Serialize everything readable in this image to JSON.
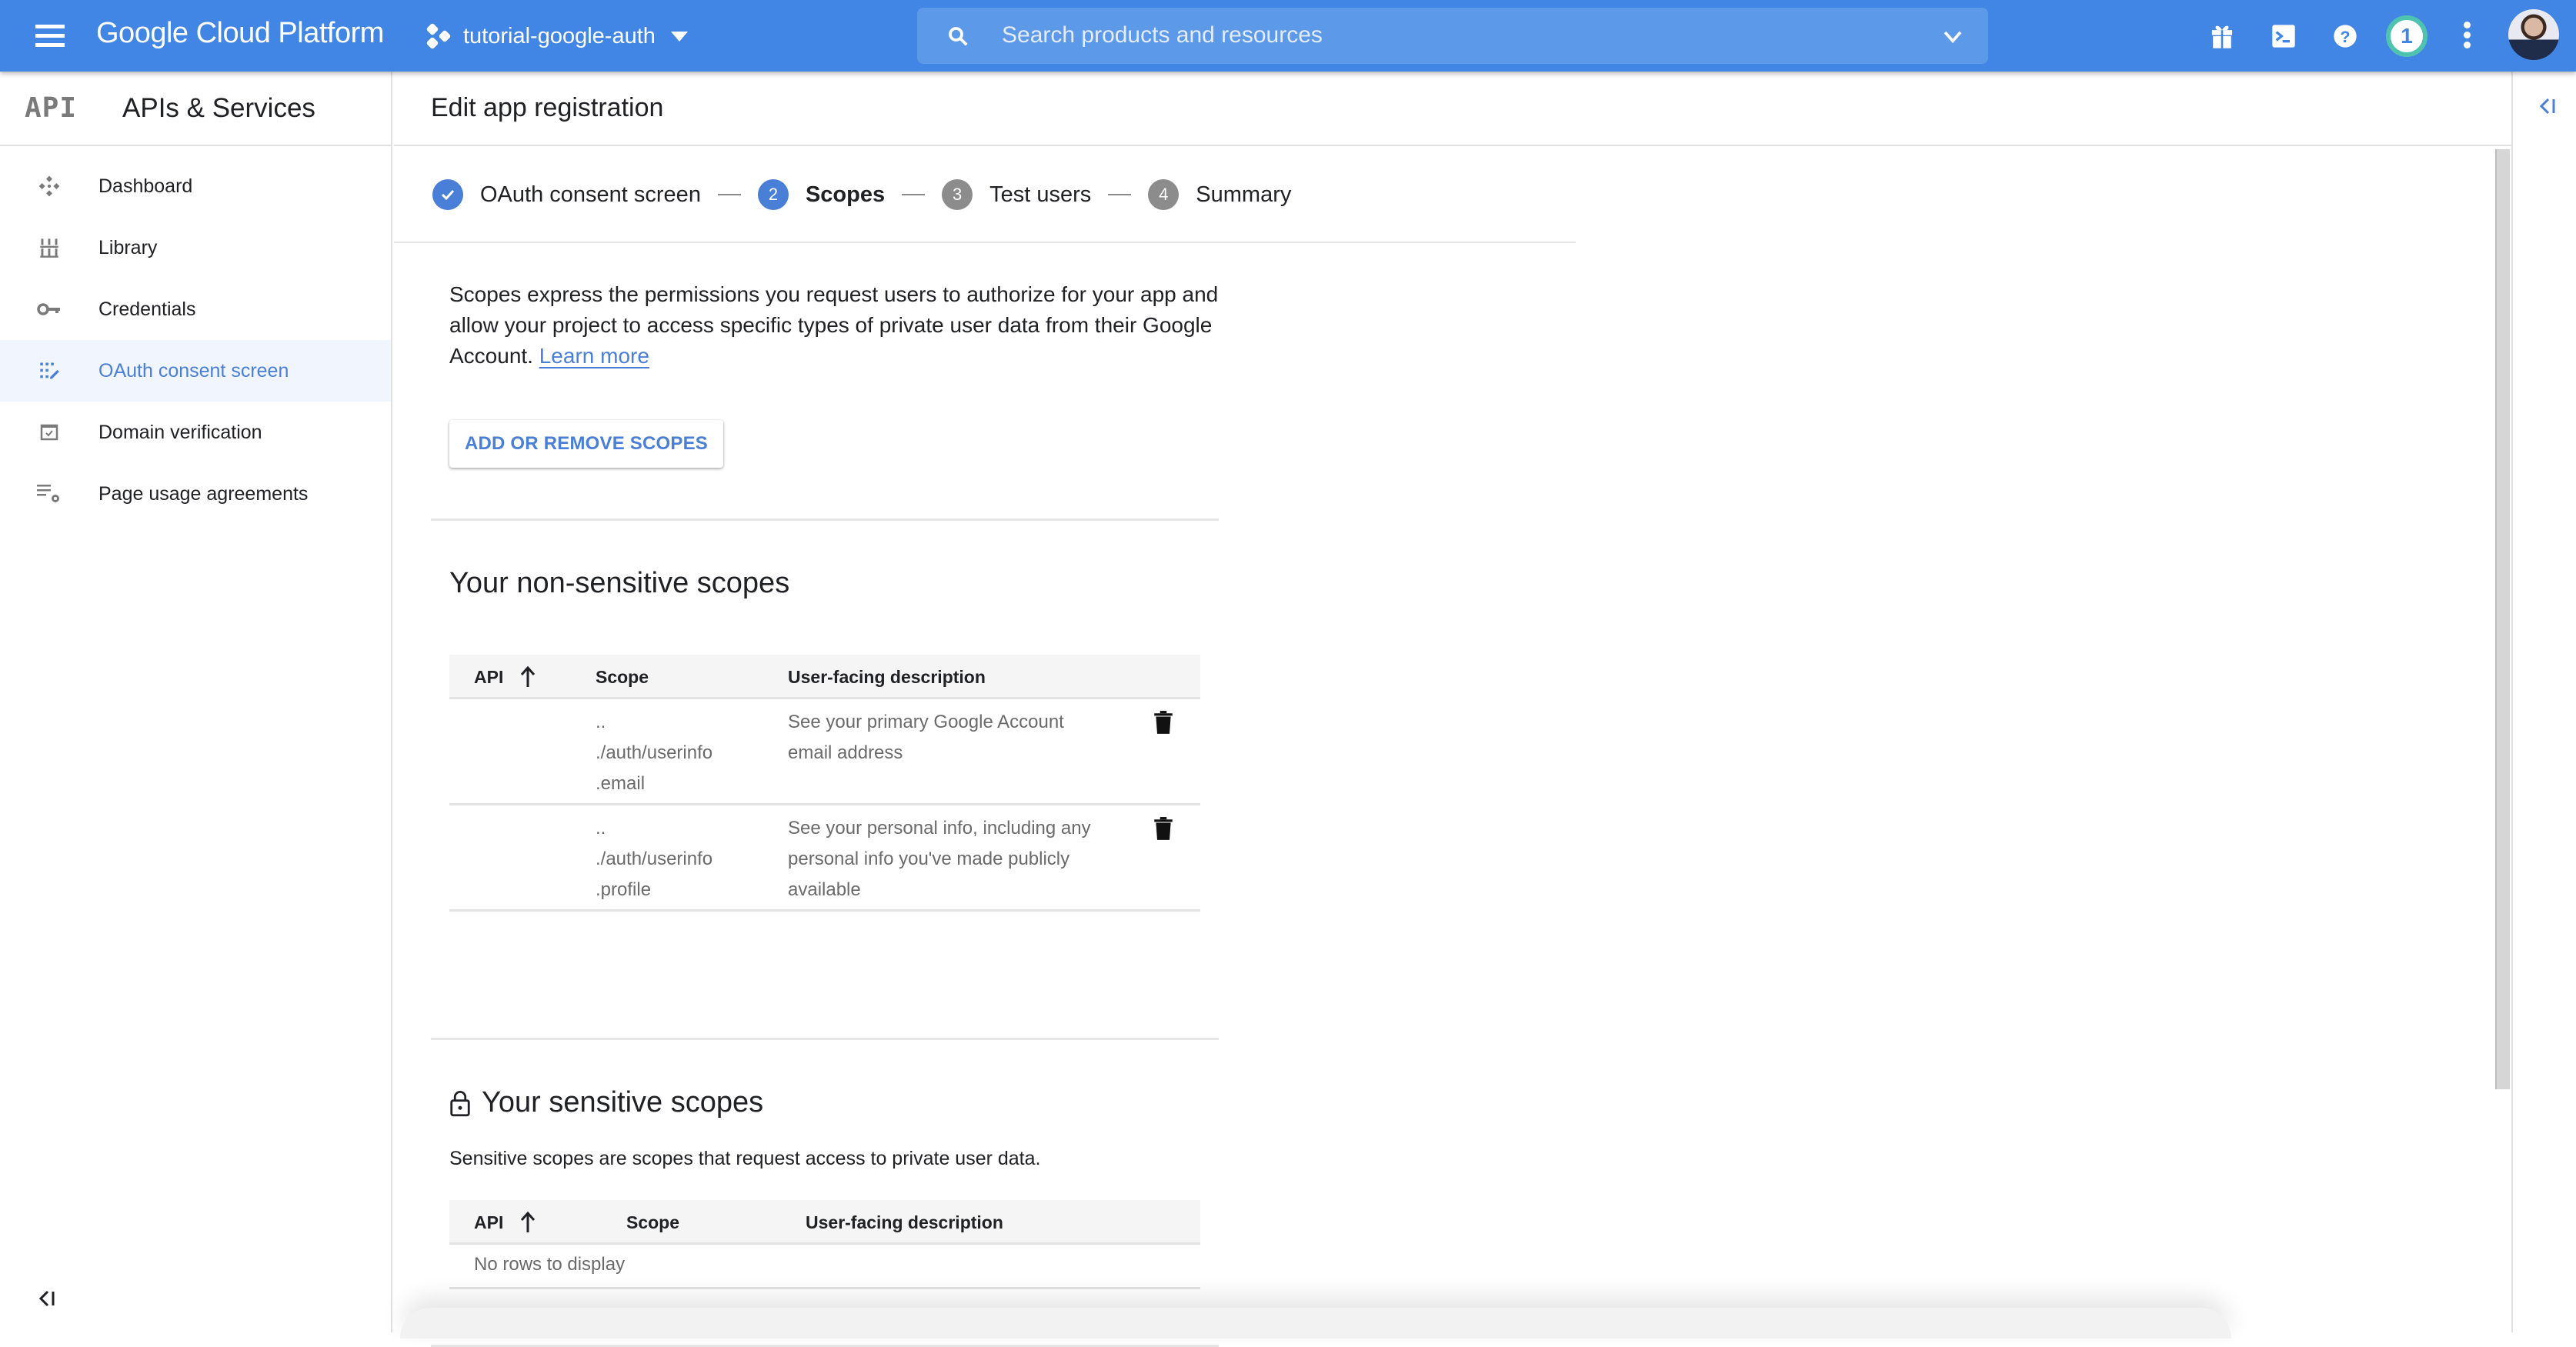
{
  "topbar": {
    "brand": "Google Cloud Platform",
    "project": "tutorial-google-auth",
    "search_placeholder": "Search products and resources",
    "notification_count": "1",
    "icons": [
      "menu-icon",
      "project-icon",
      "search-icon",
      "chevron-down-icon",
      "gift-icon",
      "cloud-shell-icon",
      "help-icon",
      "notifications-icon",
      "more-vert-icon",
      "avatar"
    ]
  },
  "sidebar": {
    "logo": "API",
    "title": "APIs & Services",
    "items": [
      {
        "label": "Dashboard",
        "icon": "dashboard-icon",
        "active": false
      },
      {
        "label": "Library",
        "icon": "library-icon",
        "active": false
      },
      {
        "label": "Credentials",
        "icon": "key-icon",
        "active": false
      },
      {
        "label": "OAuth consent screen",
        "icon": "oauth-consent-icon",
        "active": true
      },
      {
        "label": "Domain verification",
        "icon": "domain-check-icon",
        "active": false
      },
      {
        "label": "Page usage agreements",
        "icon": "settings-list-icon",
        "active": false
      }
    ],
    "collapse_label": "<|"
  },
  "main": {
    "title": "Edit app registration",
    "steps": [
      {
        "number": "✓",
        "label": "OAuth consent screen",
        "state": "done"
      },
      {
        "number": "2",
        "label": "Scopes",
        "state": "current"
      },
      {
        "number": "3",
        "label": "Test users",
        "state": "todo"
      },
      {
        "number": "4",
        "label": "Summary",
        "state": "todo"
      }
    ],
    "intro_text": "Scopes express the permissions you request users to authorize for your app and allow your project to access specific types of private user data from their Google Account.",
    "learn_more": "Learn more",
    "add_button": "ADD OR REMOVE SCOPES",
    "non_sensitive": {
      "title": "Your non-sensitive scopes",
      "columns": [
        "API",
        "Scope",
        "User-facing description"
      ],
      "rows": [
        {
          "api": "",
          "scope_lines": [
            "..",
            "./auth/userinfo",
            ".email"
          ],
          "description": "See your primary Google Account email address"
        },
        {
          "api": "",
          "scope_lines": [
            "..",
            "./auth/userinfo",
            ".profile"
          ],
          "description": "See your personal info, including any personal info you've made publicly available"
        }
      ]
    },
    "sensitive": {
      "title": "Your sensitive scopes",
      "subtitle": "Sensitive scopes are scopes that request access to private user data.",
      "columns": [
        "API",
        "Scope",
        "User-facing description"
      ],
      "empty_text": "No rows to display"
    }
  },
  "colors": {
    "topbar": "#4186e4",
    "accent": "#4a7fd8",
    "active_bg": "#f1f5fd",
    "notif_ring": "#4fc3b0"
  }
}
